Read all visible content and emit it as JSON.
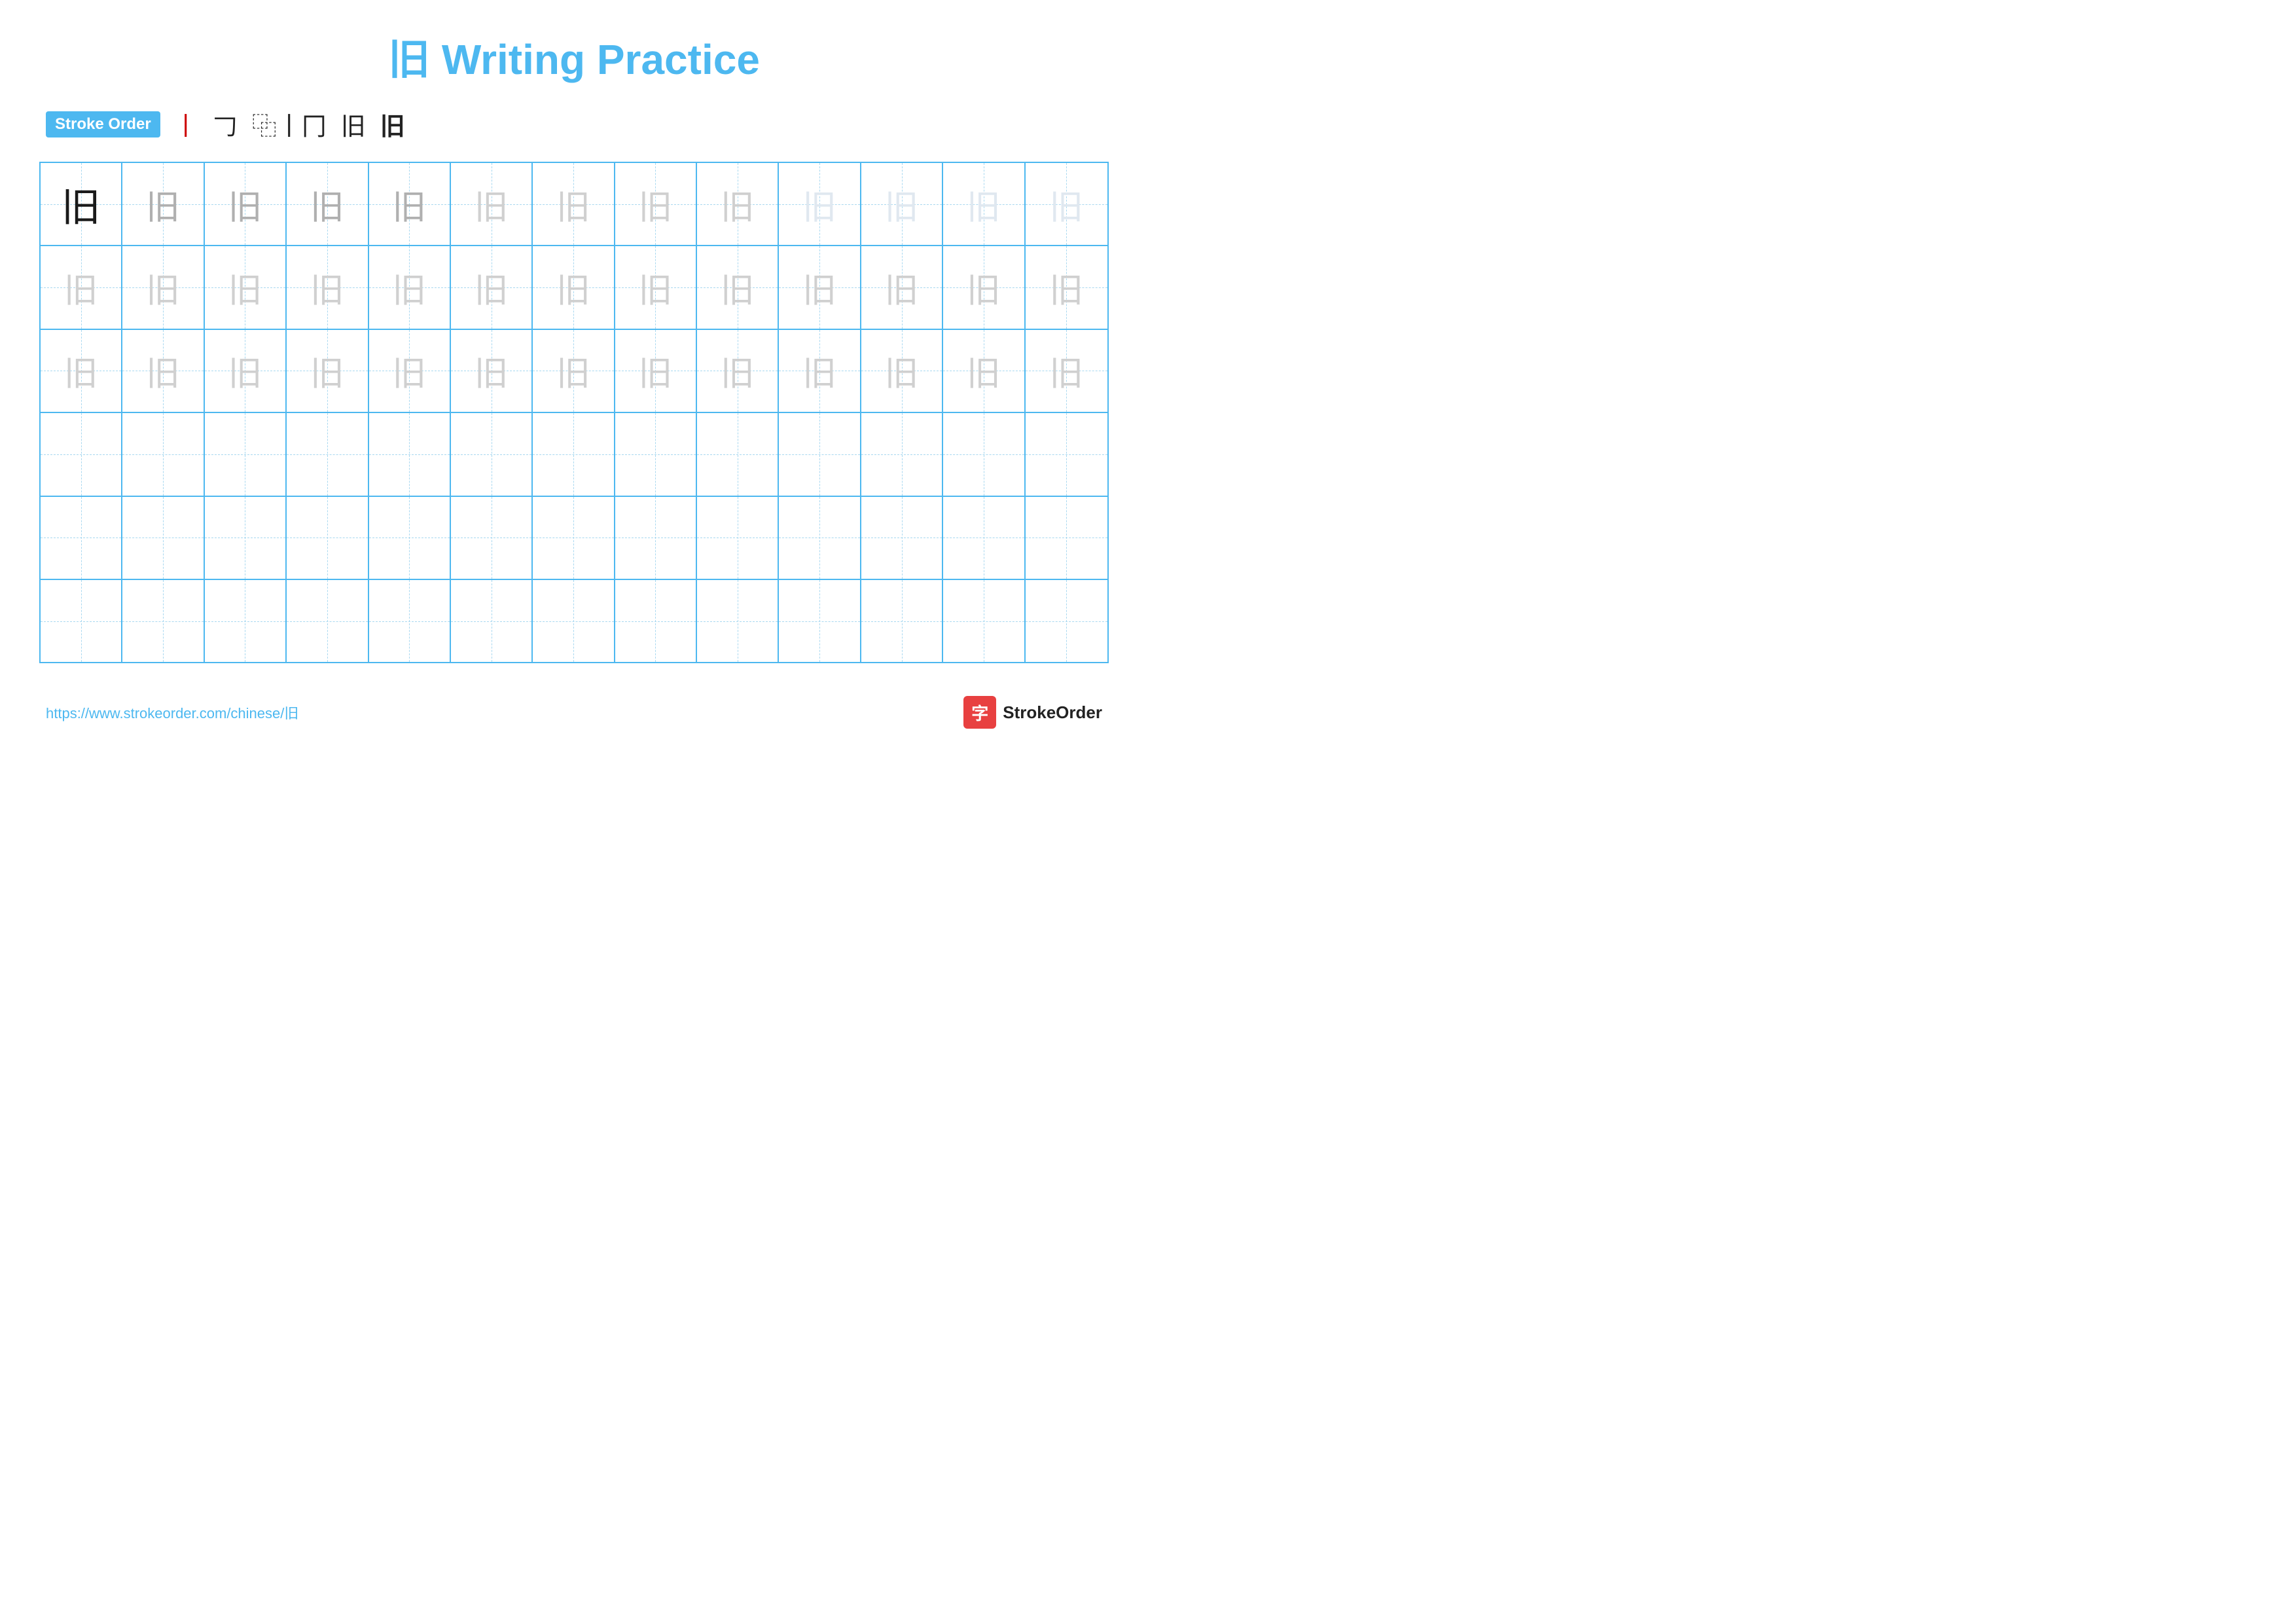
{
  "title": {
    "character": "旧",
    "label": "Writing Practice",
    "full": "旧 Writing Practice"
  },
  "stroke_order": {
    "badge_label": "Stroke Order",
    "steps": [
      "丨",
      "𠃌",
      "旧",
      "旧",
      "旧"
    ]
  },
  "grid": {
    "rows": 6,
    "cols": 13,
    "character": "旧",
    "row_data": [
      {
        "type": "dark-then-fading",
        "shades": [
          "dark",
          "medium",
          "medium",
          "medium",
          "medium",
          "light",
          "light",
          "light",
          "light",
          "very-light",
          "very-light",
          "very-light",
          "very-light"
        ]
      },
      {
        "type": "fading",
        "shades": [
          "light",
          "light",
          "light",
          "light",
          "light",
          "light",
          "light",
          "light",
          "light",
          "light",
          "light",
          "light",
          "light"
        ]
      },
      {
        "type": "fading",
        "shades": [
          "light",
          "light",
          "light",
          "light",
          "light",
          "light",
          "light",
          "light",
          "light",
          "light",
          "light",
          "light",
          "light"
        ]
      },
      {
        "type": "empty"
      },
      {
        "type": "empty"
      },
      {
        "type": "empty"
      }
    ]
  },
  "footer": {
    "url": "https://www.strokeorder.com/chinese/旧",
    "logo_icon": "字",
    "logo_text": "StrokeOrder"
  }
}
